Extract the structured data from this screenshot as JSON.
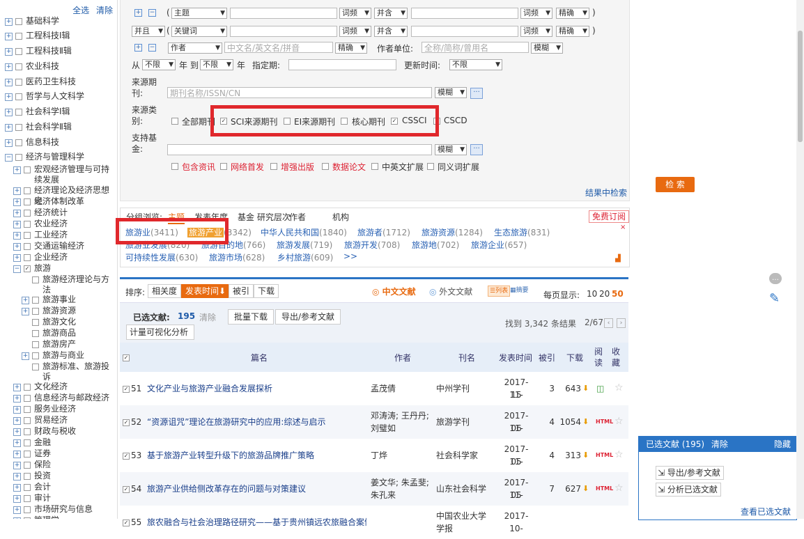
{
  "left_tree": {
    "select_all": "全选",
    "clear": "清除",
    "items": [
      {
        "label": "基础科学",
        "pm": "+",
        "checked": false
      },
      {
        "label": "工程科技Ⅰ辑",
        "pm": "+",
        "checked": false
      },
      {
        "label": "工程科技Ⅱ辑",
        "pm": "+",
        "checked": false
      },
      {
        "label": "农业科技",
        "pm": "+",
        "checked": false
      },
      {
        "label": "医药卫生科技",
        "pm": "+",
        "checked": false
      },
      {
        "label": "哲学与人文科学",
        "pm": "+",
        "checked": false
      },
      {
        "label": "社会科学Ⅰ辑",
        "pm": "+",
        "checked": false
      },
      {
        "label": "社会科学Ⅱ辑",
        "pm": "+",
        "checked": false
      },
      {
        "label": "信息科技",
        "pm": "+",
        "checked": false
      },
      {
        "label": "经济与管理科学",
        "pm": "-",
        "checked": false
      },
      {
        "label": "宏观经济管理与可持续发展",
        "pm": "+",
        "checked": false
      },
      {
        "label": "经济理论及经济思想史",
        "pm": "+",
        "checked": false
      },
      {
        "label": "经济体制改革",
        "pm": "+",
        "checked": false
      },
      {
        "label": "经济统计",
        "pm": "+",
        "checked": false
      },
      {
        "label": "农业经济",
        "pm": "+",
        "checked": false
      },
      {
        "label": "工业经济",
        "pm": "+",
        "checked": false
      },
      {
        "label": "交通运输经济",
        "pm": "+",
        "checked": false
      },
      {
        "label": "企业经济",
        "pm": "+",
        "checked": false
      },
      {
        "label": "旅游",
        "pm": "-",
        "checked": true
      },
      {
        "label": "旅游经济理论与方法",
        "pm": "",
        "checked": false
      },
      {
        "label": "旅游事业",
        "pm": "+",
        "checked": false
      },
      {
        "label": "旅游资源",
        "pm": "+",
        "checked": false
      },
      {
        "label": "旅游文化",
        "pm": "",
        "checked": false
      },
      {
        "label": "旅游商品",
        "pm": "",
        "checked": false
      },
      {
        "label": "旅游房产",
        "pm": "",
        "checked": false
      },
      {
        "label": "旅游与商业",
        "pm": "+",
        "checked": false
      },
      {
        "label": "旅游标准、旅游投诉",
        "pm": "",
        "checked": false
      },
      {
        "label": "文化经济",
        "pm": "+",
        "checked": false
      },
      {
        "label": "信息经济与邮政经济",
        "pm": "+",
        "checked": false
      },
      {
        "label": "服务业经济",
        "pm": "+",
        "checked": false
      },
      {
        "label": "贸易经济",
        "pm": "+",
        "checked": false
      },
      {
        "label": "财政与税收",
        "pm": "+",
        "checked": false
      },
      {
        "label": "金融",
        "pm": "+",
        "checked": false
      },
      {
        "label": "证券",
        "pm": "+",
        "checked": false
      },
      {
        "label": "保险",
        "pm": "+",
        "checked": false
      },
      {
        "label": "投资",
        "pm": "+",
        "checked": false
      },
      {
        "label": "会计",
        "pm": "+",
        "checked": false
      },
      {
        "label": "审计",
        "pm": "+",
        "checked": false
      },
      {
        "label": "市场研究与信息",
        "pm": "+",
        "checked": false
      },
      {
        "label": "管理学",
        "pm": "+",
        "checked": false
      }
    ]
  },
  "search": {
    "row1": {
      "paren_open": "(",
      "field": "主题",
      "term_freq": "词频",
      "and": "并含",
      "term_freq2": "词频",
      "match": "精确",
      "paren_close": ")"
    },
    "row2": {
      "logic": "并且",
      "field": "关键词",
      "term_freq": "词频",
      "and": "并含",
      "term_freq2": "词频",
      "match": "精确",
      "paren_open": "(",
      "paren_close": ")"
    },
    "row3": {
      "field": "作者",
      "placeholder": "中文名/英文名/拼音",
      "match": "精确",
      "org_label": "作者单位:",
      "org_placeholder": "全称/简称/曾用名",
      "org_match": "模糊"
    },
    "row4": {
      "from": "从",
      "from_sel": "不限",
      "year_to": "年 到",
      "to_sel": "不限",
      "year": "年",
      "specify": "指定期:",
      "update_label": "更新时间:",
      "update_sel": "不限"
    },
    "source": {
      "label": "来源期刊:",
      "placeholder": "期刊名称/ISSN/CN",
      "match": "模糊",
      "more": "···"
    },
    "source_type": {
      "label": "来源类别:",
      "all": "全部期刊",
      "sci": "SCI来源期刊",
      "ei": "EI来源期刊",
      "core": "核心期刊",
      "cssci": "CSSCI",
      "cscd": "CSCD"
    },
    "fund": {
      "label": "支持基金:",
      "match": "模糊",
      "more": "···"
    },
    "options": [
      "包含资讯",
      "网络首发",
      "增强出版",
      "数据论文",
      "中英文扩展",
      "同义词扩展"
    ],
    "search_button": "检 索",
    "search_in_results": "结果中检索"
  },
  "group": {
    "label": "分组浏览:",
    "tabs": [
      "主题",
      "发表年度",
      "基金",
      "研究层次",
      "作者",
      "机构"
    ],
    "free_subscribe": "免费订阅",
    "row1": [
      {
        "t": "旅游业",
        "n": "(3411)"
      },
      {
        "t": "旅游产业",
        "n": "(3342)"
      },
      {
        "t": "中华人民共和国",
        "n": "(1840)"
      },
      {
        "t": "旅游者",
        "n": "(1712)"
      },
      {
        "t": "旅游资源",
        "n": "(1284)"
      },
      {
        "t": "生态旅游",
        "n": "(831)"
      }
    ],
    "row2": [
      {
        "t": "旅游业发展",
        "n": "(820)"
      },
      {
        "t": "旅游目的地",
        "n": "(766)"
      },
      {
        "t": "旅游发展",
        "n": "(719)"
      },
      {
        "t": "旅游开发",
        "n": "(708)"
      },
      {
        "t": "旅游地",
        "n": "(702)"
      },
      {
        "t": "旅游企业",
        "n": "(657)"
      }
    ],
    "row3": [
      {
        "t": "可持续性发展",
        "n": "(630)"
      },
      {
        "t": "旅游市场",
        "n": "(628)"
      },
      {
        "t": "乡村旅游",
        "n": "(609)"
      },
      {
        "t": ">>",
        "n": ""
      }
    ]
  },
  "sortbar": {
    "label": "排序:",
    "options": [
      "相关度",
      "发表时间⬇",
      "被引",
      "下载"
    ],
    "cn": "中文文献",
    "foreign": "外文文献",
    "list": "列表",
    "abstract": "摘要",
    "per_page_label": "每页显示:",
    "per_page": [
      "10",
      "20",
      "50"
    ]
  },
  "selection": {
    "selected_label": "已选文献:",
    "selected_count": "195",
    "clear": "清除",
    "batch_download": "批量下载",
    "export": "导出/参考文献",
    "visual": "计量可视化分析",
    "found": "找到 3,342 条结果",
    "page": "2/67"
  },
  "table": {
    "headers": [
      "篇名",
      "作者",
      "刊名",
      "发表时间",
      "被引",
      "下载",
      "阅读",
      "收藏"
    ],
    "rows": [
      {
        "num": "51",
        "title": "文化产业与旅游产业融合发展探析",
        "author": "孟茂倩",
        "journal": "中州学刊",
        "date1": "2017-11-",
        "date2": "15",
        "cited": "3",
        "dl": "643",
        "read": "book"
      },
      {
        "num": "52",
        "title": "“资源诅咒”理论在旅游研究中的应用:综述与启示",
        "author": "邓涛涛; 王丹丹; 刘璧如",
        "journal": "旅游学刊",
        "date1": "2017-11-",
        "date2": "06",
        "cited": "4",
        "dl": "1054",
        "read": "HTML"
      },
      {
        "num": "53",
        "title": "基于旅游产业转型升级下的旅游品牌推广策略",
        "author": "丁烨",
        "journal": "社会科学家",
        "date1": "2017-11-",
        "date2": "05",
        "cited": "4",
        "dl": "313",
        "read": "HTML"
      },
      {
        "num": "54",
        "title": "旅游产业供给侧改革存在的问题与对策建议",
        "author": "姜文华; 朱孟斐; 朱孔来",
        "journal": "山东社会科学",
        "date1": "2017-11-",
        "date2": "05",
        "cited": "7",
        "dl": "627",
        "read": "HTML"
      },
      {
        "num": "55",
        "title": "旅农融合与社会治理路径研究——基于贵州镇远农旅融合案例",
        "author": "",
        "journal": "中国农业大学学报",
        "date1": "2017-10-",
        "date2": "",
        "cited": "",
        "dl": "",
        "read": ""
      }
    ]
  },
  "side_panel": {
    "title": "已选文献 (195)",
    "clear": "清除",
    "hide": "隐藏",
    "export": "导出/参考文献",
    "analyze": "分析已选文献",
    "view": "查看已选文献"
  }
}
